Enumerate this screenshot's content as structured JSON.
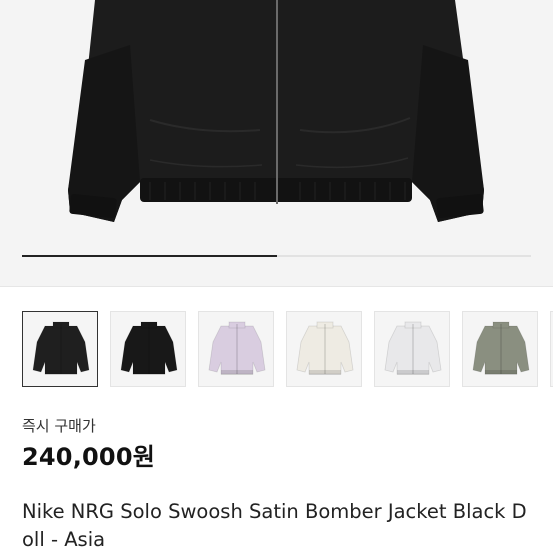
{
  "hero": {
    "progress": 0.5
  },
  "thumbnails": [
    {
      "name": "black-jacket-front-selected",
      "color": "#1f1f1f"
    },
    {
      "name": "black-jacket-front-2",
      "color": "#181818"
    },
    {
      "name": "lilac-jacket",
      "color": "#d9cde0"
    },
    {
      "name": "cream-jacket",
      "color": "#eeebe3"
    },
    {
      "name": "white-jacket",
      "color": "#e8e8ea"
    },
    {
      "name": "olive-jacket",
      "color": "#8a8f80"
    },
    {
      "name": "partial-jacket",
      "color": "#d0d0d0"
    }
  ],
  "purchase": {
    "label": "즉시 구매가",
    "price": "240,000원"
  },
  "product": {
    "title": "Nike NRG Solo Swoosh Satin Bomber Jacket Black Doll - Asia"
  }
}
